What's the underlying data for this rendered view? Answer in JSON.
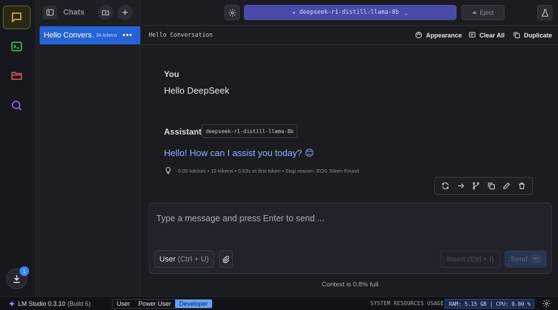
{
  "chats": {
    "title": "Chats",
    "items": [
      {
        "label": "Hello Convers…",
        "tokens": "34 tokens"
      }
    ]
  },
  "topbar": {
    "model": "deepseek-r1-distill-llama-8b",
    "eject": "Eject"
  },
  "conversation": {
    "title": "Hello Conversation",
    "actions": {
      "appearance": "Appearance",
      "clear_all": "Clear All",
      "duplicate": "Duplicate"
    }
  },
  "messages": {
    "user": {
      "role": "You",
      "text": "Hello DeepSeek"
    },
    "assistant": {
      "role": "Assistant",
      "model_tag": "deepseek-r1-distill-llama-8b",
      "text": "Hello! How can I assist you today? 😊",
      "stats": "6.00 tok/sec • 15 tokens • 0.63s to first token • Stop reason: EOS Token Found"
    }
  },
  "composer": {
    "placeholder": "Type a message and press Enter to send ...",
    "user_label": "User",
    "user_shortcut": "(Ctrl + U)",
    "insert_label": "Insert (Ctrl + I)",
    "send_label": "Send",
    "send_key": "↵",
    "context": "Context is 0.8% full"
  },
  "rail": {
    "download_badge": "1"
  },
  "statusbar": {
    "app_name": "LM Studio 0.3.10",
    "build": "(Build 6)",
    "modes": [
      "User",
      "Power User",
      "Developer"
    ],
    "active_mode": "Developer",
    "system_label": "SYSTEM RESOURCES USAGE:",
    "resources": "RAM: 5.15 GB | CPU: 0.00 %"
  },
  "colors": {
    "accent_blue": "#2563d4",
    "model_purple": "#4b4aa8",
    "assistant_text": "#8fb4ff",
    "active_rail": "#e2c35a"
  }
}
